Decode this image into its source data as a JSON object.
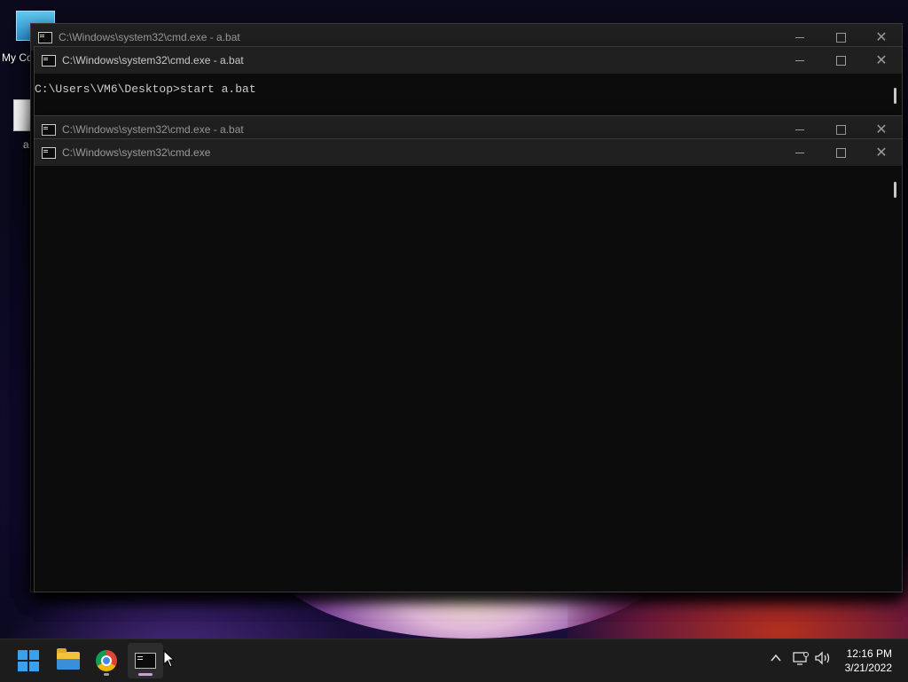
{
  "desktop": {
    "icons": [
      {
        "label": "My Co",
        "icon": "computer-icon"
      },
      {
        "label": "a",
        "icon": "file-icon"
      }
    ]
  },
  "windows": [
    {
      "title": "C:\\Windows\\system32\\cmd.exe - a.bat",
      "active": false
    },
    {
      "title": "C:\\Windows\\system32\\cmd.exe - a.bat",
      "active": true,
      "console_text": "C:\\Users\\VM6\\Desktop>start a.bat"
    },
    {
      "title": "C:\\Windows\\system32\\cmd.exe - a.bat",
      "active": false
    },
    {
      "title": "C:\\Windows\\system32\\cmd.exe",
      "active": false
    }
  ],
  "window_controls": {
    "minimize": "minimize-icon",
    "maximize": "maximize-icon",
    "close": "close-icon"
  },
  "taskbar": {
    "apps": [
      {
        "name": "start",
        "icon": "windows-logo-icon"
      },
      {
        "name": "file-explorer",
        "icon": "folder-icon"
      },
      {
        "name": "chrome",
        "icon": "chrome-icon"
      },
      {
        "name": "command-prompt",
        "icon": "terminal-icon",
        "active": true
      }
    ],
    "tray": {
      "chevron": "^",
      "network_icon": "network-icon",
      "volume_icon": "volume-icon"
    },
    "clock": {
      "time": "12:16 PM",
      "date": "3/21/2022"
    }
  }
}
